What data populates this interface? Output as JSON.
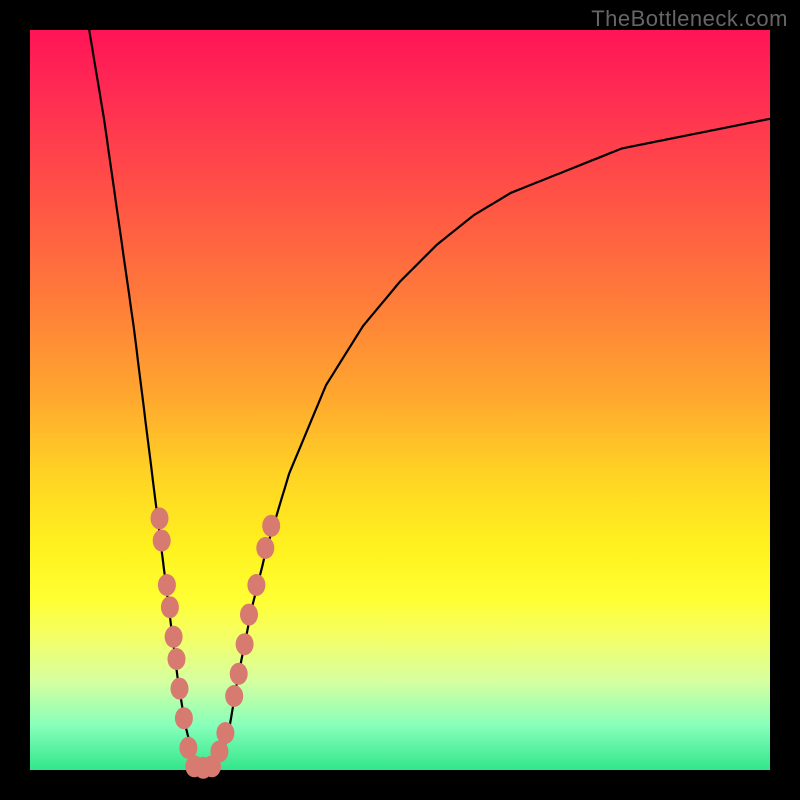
{
  "watermark": "TheBottleneck.com",
  "chart_data": {
    "type": "line",
    "title": "",
    "xlabel": "",
    "ylabel": "",
    "xlim": [
      0,
      100
    ],
    "ylim": [
      0,
      100
    ],
    "grid": false,
    "legend": false,
    "background": "rainbow-vertical-gradient-red-to-green",
    "series": [
      {
        "name": "bottleneck-curve",
        "stroke": "#000000",
        "x": [
          8,
          10,
          12,
          14,
          16,
          18,
          19,
          20,
          21,
          22,
          23,
          24,
          25,
          26,
          27,
          28,
          30,
          32,
          35,
          40,
          45,
          50,
          55,
          60,
          65,
          70,
          75,
          80,
          85,
          90,
          95,
          100
        ],
        "y": [
          100,
          88,
          74,
          60,
          44,
          28,
          20,
          12,
          6,
          2,
          0,
          0,
          0,
          2,
          6,
          12,
          22,
          30,
          40,
          52,
          60,
          66,
          71,
          75,
          78,
          80,
          82,
          84,
          85,
          86,
          87,
          88
        ]
      }
    ],
    "markers": {
      "name": "highlight-cluster",
      "fill": "#d77a6f",
      "points": [
        {
          "x": 17.5,
          "y": 34
        },
        {
          "x": 17.8,
          "y": 31
        },
        {
          "x": 18.5,
          "y": 25
        },
        {
          "x": 18.9,
          "y": 22
        },
        {
          "x": 19.4,
          "y": 18
        },
        {
          "x": 19.8,
          "y": 15
        },
        {
          "x": 20.2,
          "y": 11
        },
        {
          "x": 20.8,
          "y": 7
        },
        {
          "x": 21.4,
          "y": 3
        },
        {
          "x": 22.2,
          "y": 0.5
        },
        {
          "x": 23.4,
          "y": 0.3
        },
        {
          "x": 24.6,
          "y": 0.5
        },
        {
          "x": 25.6,
          "y": 2.5
        },
        {
          "x": 26.4,
          "y": 5
        },
        {
          "x": 27.6,
          "y": 10
        },
        {
          "x": 28.2,
          "y": 13
        },
        {
          "x": 29.0,
          "y": 17
        },
        {
          "x": 29.6,
          "y": 21
        },
        {
          "x": 30.6,
          "y": 25
        },
        {
          "x": 31.8,
          "y": 30
        },
        {
          "x": 32.6,
          "y": 33
        }
      ]
    }
  }
}
